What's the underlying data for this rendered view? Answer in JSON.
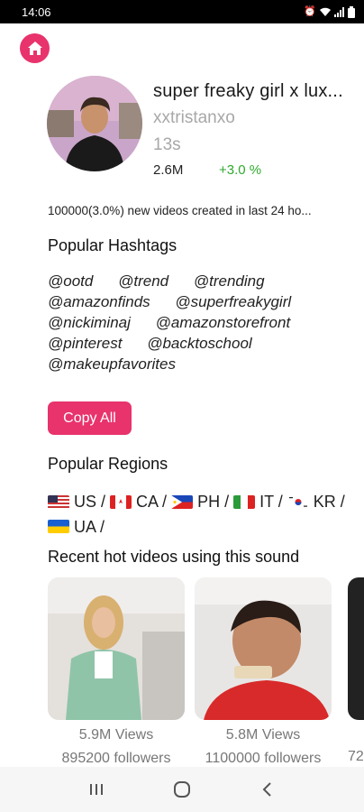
{
  "status_bar": {
    "time": "14:06",
    "icons": [
      "alarm-icon",
      "wifi-icon",
      "signal-icon",
      "battery-icon"
    ]
  },
  "header": {
    "home_icon": "home-icon"
  },
  "sound": {
    "title": "super freaky girl x lux...",
    "author": "xxtristanxo",
    "duration": "13s",
    "count": "2.6M",
    "growth": "+3.0 %"
  },
  "summary": "100000(3.0%) new videos created in last 24 ho...",
  "hashtags": {
    "title": "Popular Hashtags",
    "items": [
      "@ootd",
      "@trend",
      "@trending",
      "@amazonfinds",
      "@superfreakygirl",
      "@nickiminaj",
      "@amazonstorefront",
      "@pinterest",
      "@backtoschool",
      "@makeupfavorites"
    ],
    "copy_label": "Copy All"
  },
  "regions": {
    "title": "Popular Regions",
    "items": [
      {
        "flag": "flag-us",
        "code": "US /"
      },
      {
        "flag": "flag-ca",
        "code": "CA /"
      },
      {
        "flag": "flag-ph",
        "code": "PH /"
      },
      {
        "flag": "flag-it",
        "code": "IT /"
      },
      {
        "flag": "flag-kr",
        "code": "KR /"
      },
      {
        "flag": "flag-ua",
        "code": "UA /"
      }
    ]
  },
  "videos": {
    "title": "Recent hot videos using this sound",
    "items": [
      {
        "views": "5.9M Views",
        "followers": "895200 followers"
      },
      {
        "views": "5.8M Views",
        "followers": "1100000 followers"
      },
      {
        "views": "",
        "followers": "72"
      }
    ]
  },
  "nav": {
    "recents_icon": "recents-icon",
    "home_icon": "home-circle-icon",
    "back_icon": "back-icon"
  },
  "colors": {
    "accent": "#e8336d",
    "positive": "#2eaa2e",
    "muted": "#a8a8a8"
  }
}
